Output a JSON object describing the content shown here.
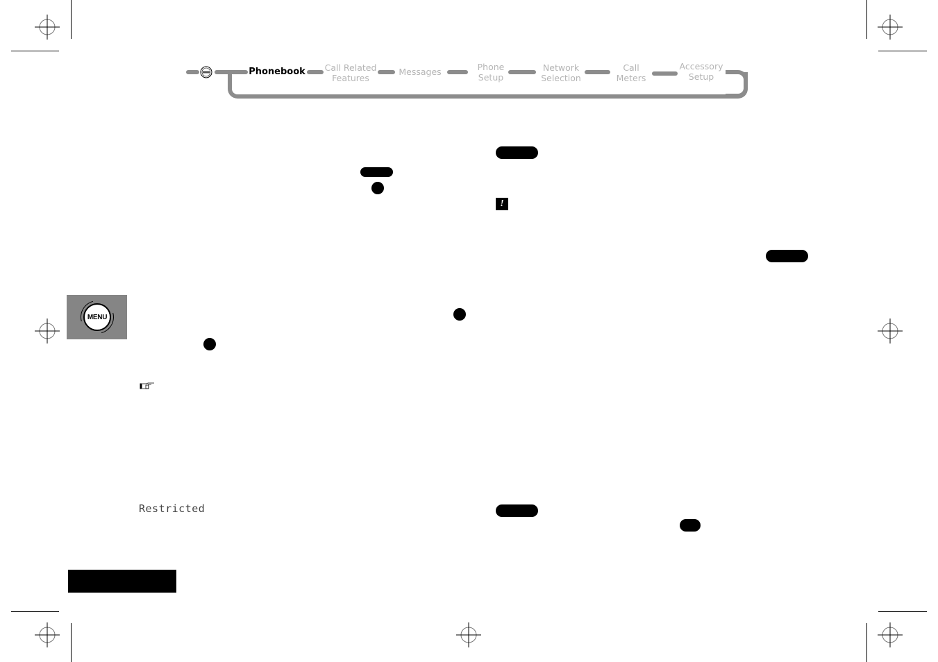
{
  "nav": {
    "menu_icon": "menu-icon",
    "items": [
      {
        "label": "Phonebook",
        "active": true
      },
      {
        "label": "Call Related\nFeatures",
        "active": false
      },
      {
        "label": "Messages",
        "active": false
      },
      {
        "label": "Phone\nSetup",
        "active": false
      },
      {
        "label": "Network\nSelection",
        "active": false
      },
      {
        "label": "Call\nMeters",
        "active": false
      },
      {
        "label": "Accessory\nSetup",
        "active": false
      }
    ],
    "active_color": "#000000",
    "inactive_color": "#b5b5b5",
    "track_color": "#8c8c8c"
  },
  "side_tab": {
    "label": "MENU",
    "background": "#858585"
  },
  "body": {
    "lcd_text": "Restricted",
    "warning_glyph": "!",
    "note_icon": "pointing-hand-icon"
  }
}
